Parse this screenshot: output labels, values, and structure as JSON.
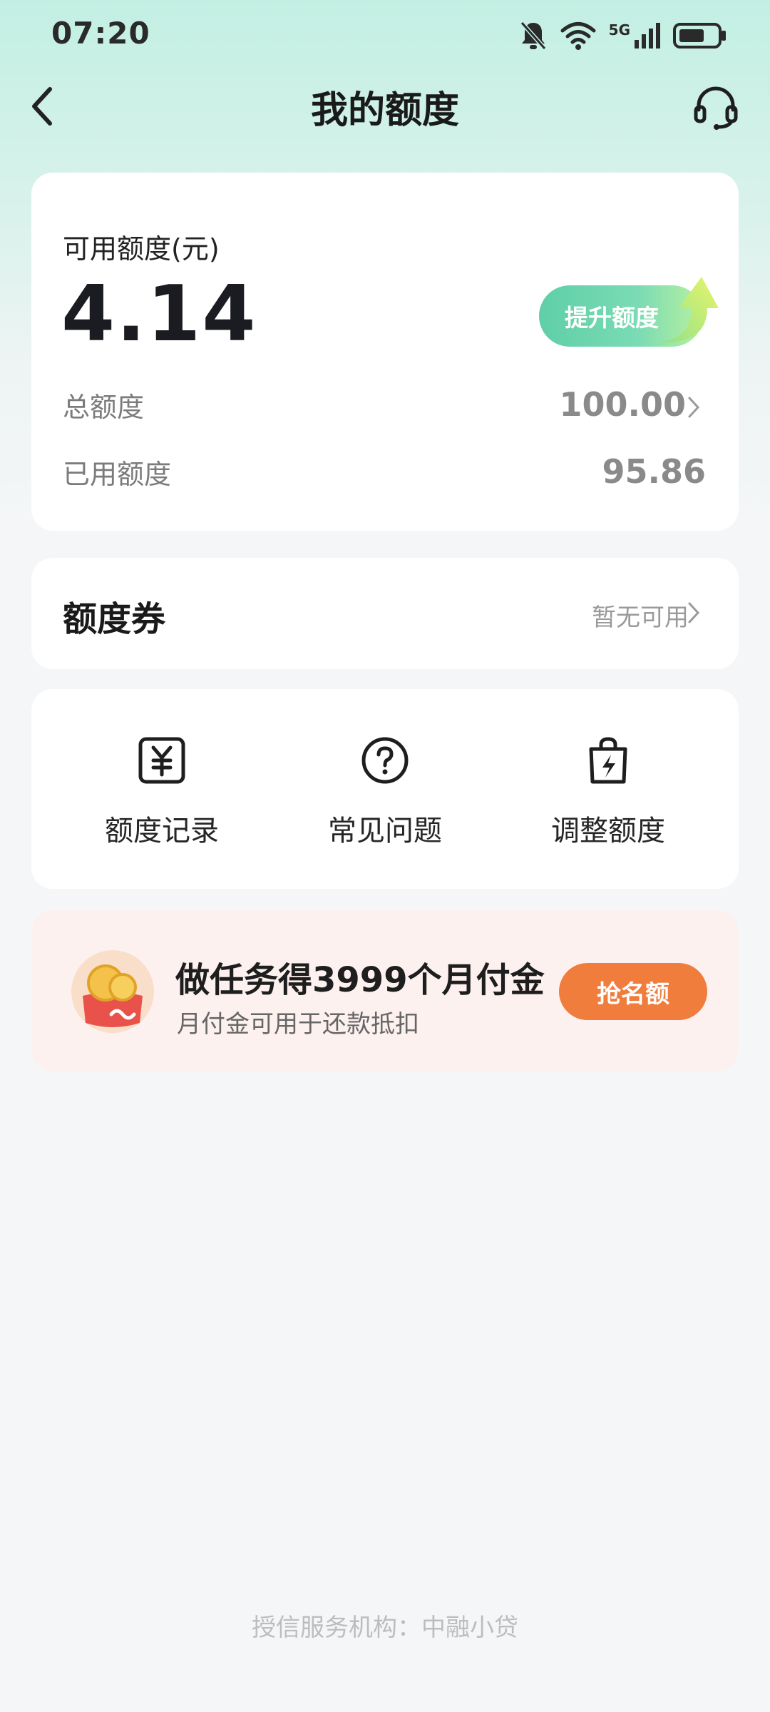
{
  "status_bar": {
    "time": "07:20",
    "icons": [
      "mute-bell-icon",
      "wifi-icon",
      "5g-signal-icon",
      "battery-icon"
    ],
    "network_label": "5G"
  },
  "header": {
    "title": "我的额度",
    "back_icon": "chevron-left-icon",
    "support_icon": "headset-icon"
  },
  "limit_card": {
    "available_label": "可用额度(元)",
    "available_value": "4.14",
    "raise_button": "提升额度",
    "total_label": "总额度",
    "total_value": "100.00",
    "used_label": "已用额度",
    "used_value": "95.86"
  },
  "coupon_card": {
    "title": "额度券",
    "status": "暂无可用"
  },
  "shortcuts": [
    {
      "label": "额度记录",
      "icon": "yuan-record-icon"
    },
    {
      "label": "常见问题",
      "icon": "question-circle-icon"
    },
    {
      "label": "调整额度",
      "icon": "shopping-bag-bolt-icon"
    }
  ],
  "promo": {
    "title": "做任务得3999个月付金",
    "subtitle": "月付金可用于还款抵扣",
    "button": "抢名额",
    "image_icon": "coin-wallet-icon"
  },
  "footer": {
    "text": "授信服务机构：中融小贷"
  },
  "colors": {
    "accent_green": "#5fcfa8",
    "promo_orange": "#f07d3c",
    "promo_bg": "#fdf1f0"
  }
}
